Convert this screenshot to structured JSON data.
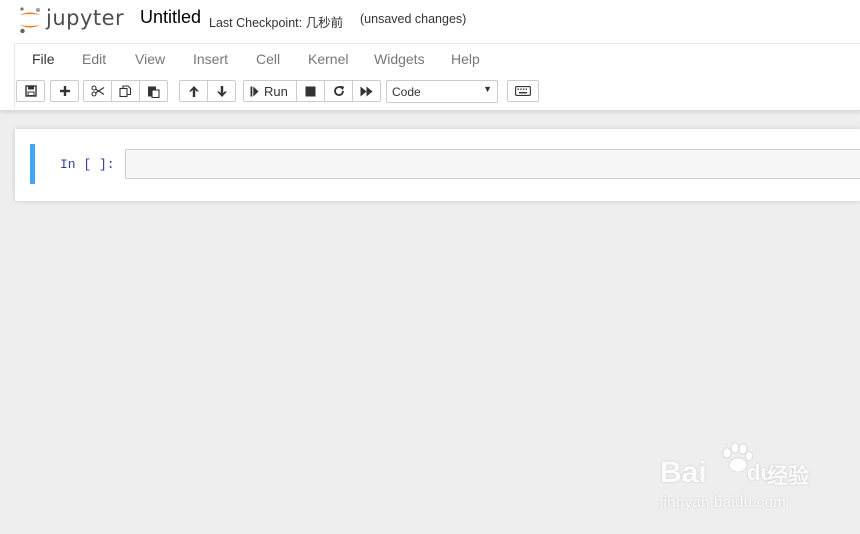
{
  "header": {
    "logo_text": "jupyter",
    "notebook_title": "Untitled",
    "checkpoint": "Last Checkpoint: 几秒前",
    "autosave_status": "(unsaved changes)"
  },
  "menu": {
    "items": [
      "File",
      "Edit",
      "View",
      "Insert",
      "Cell",
      "Kernel",
      "Widgets",
      "Help"
    ]
  },
  "toolbar": {
    "icons": [
      "save-icon",
      "plus-icon",
      "cut-icon",
      "copy-icon",
      "paste-icon",
      "arrow-up-icon",
      "arrow-down-icon",
      "step-forward-icon",
      "stop-icon",
      "refresh-icon",
      "fast-forward-icon",
      "keyboard-icon"
    ],
    "run_label": "Run",
    "cell_type": "Code",
    "cell_type_arrow": "▼"
  },
  "cell": {
    "prompt": "In [ ]:",
    "source": ""
  },
  "watermark": {
    "brand_left": "Bai",
    "brand_right": "du",
    "brand_cn": "经验",
    "url": "jingyan.baidu.com"
  },
  "colors": {
    "logo_orange": "#f37726",
    "cell_selected_border": "#42a5f5",
    "prompt_color": "#303f9f",
    "background": "#eeeeee"
  }
}
